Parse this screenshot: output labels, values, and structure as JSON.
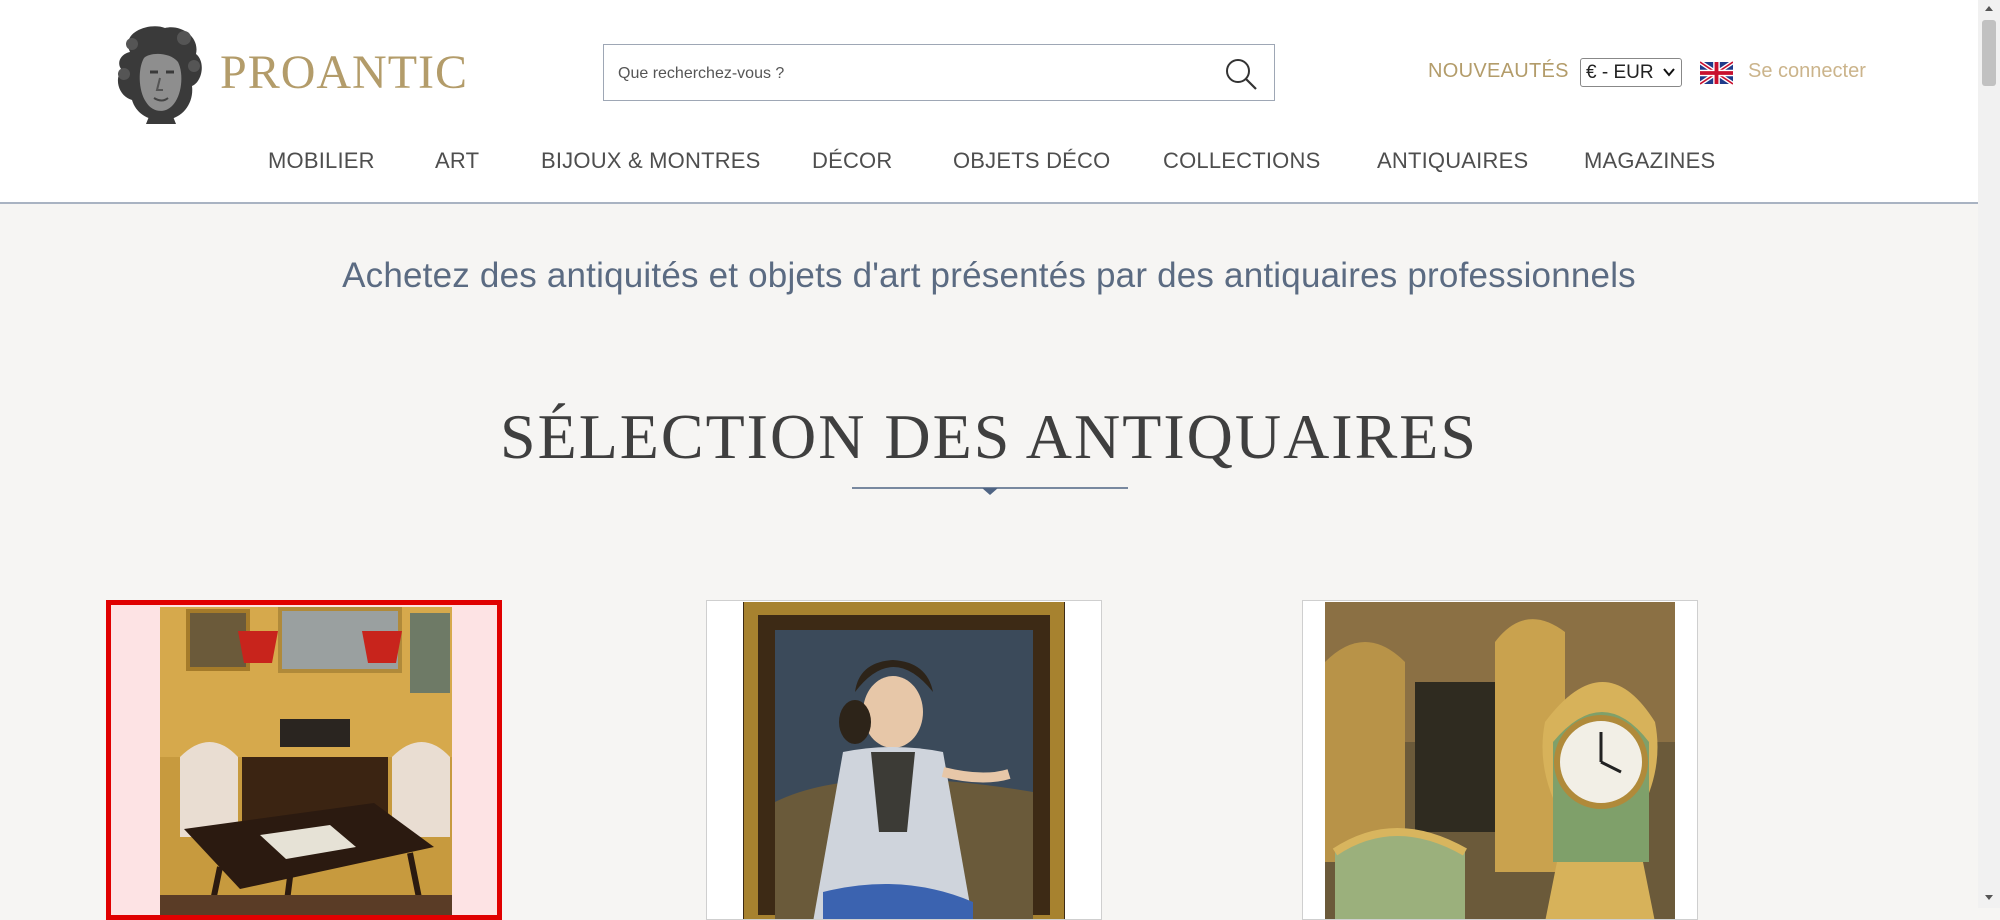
{
  "brand": {
    "name": "PROANTIC"
  },
  "search": {
    "placeholder": "Que recherchez-vous ?",
    "value": "",
    "icon": "magnifier"
  },
  "header": {
    "new_label": "NOUVEAUTÉS",
    "currency": "€ - EUR",
    "language_flag": "uk-flag",
    "login_label": "Se connecter"
  },
  "nav": {
    "items": [
      {
        "label": "MOBILIER"
      },
      {
        "label": "ART"
      },
      {
        "label": "BIJOUX & MONTRES"
      },
      {
        "label": "DÉCOR"
      },
      {
        "label": "OBJETS DÉCO"
      },
      {
        "label": "COLLECTIONS"
      },
      {
        "label": "ANTIQUAIRES"
      },
      {
        "label": "MAGAZINES"
      }
    ]
  },
  "main": {
    "tagline": "Achetez des antiquités et objets d'art présentés par des antiquaires professionnels",
    "section_title": "SÉLECTION DES ANTIQUAIRES",
    "cards": [
      {
        "image": "interior-game-table-image",
        "selected": true
      },
      {
        "image": "portrait-painting-image",
        "selected": false
      },
      {
        "image": "gilt-clock-image",
        "selected": false
      }
    ]
  },
  "colors": {
    "accent_gold": "#b39c6a",
    "nav_text": "#4e4e4e",
    "tagline": "#5b6b82",
    "selection_border": "#e00000",
    "background": "#f6f5f3"
  }
}
